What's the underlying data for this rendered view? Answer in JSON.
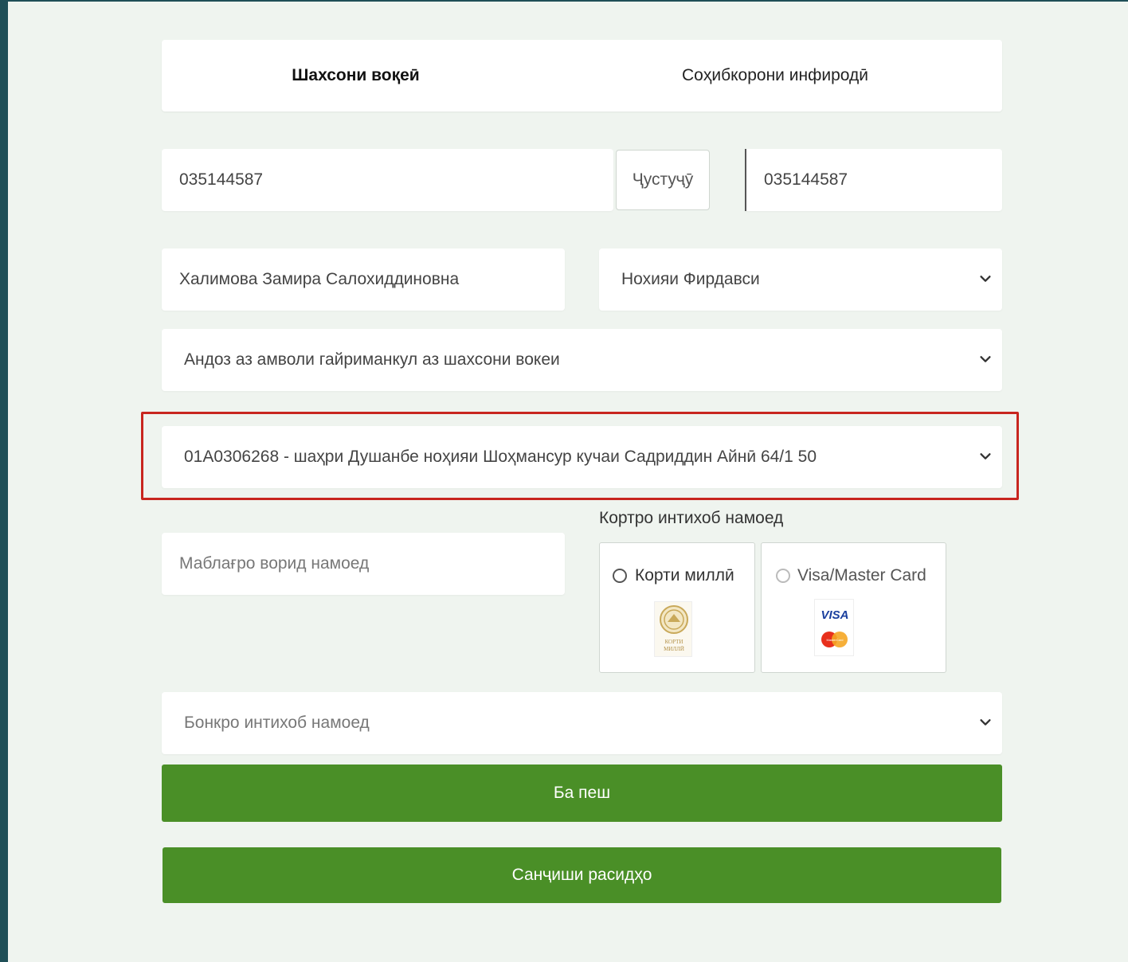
{
  "tabs": {
    "tab1": "Шахсони воқеӣ",
    "tab2": "Соҳибкорони инфиродӣ"
  },
  "tin_input": {
    "value": "035144587"
  },
  "search_button": {
    "label": "Ҷустуҷӯ"
  },
  "tin_result": {
    "value": "035144587"
  },
  "full_name": {
    "value": "Халимова Замира Салохиддиновна"
  },
  "district_select": {
    "value": "Нохияи Фирдавси"
  },
  "tax_type_select": {
    "value": "Андоз аз амволи гайриманкул аз шахсони вокеи"
  },
  "property_select": {
    "value": "01А0306268 - шаҳри Душанбе ноҳияи Шоҳмансур кучаи Садриддин Айнӣ 64/1 50"
  },
  "amount_input": {
    "placeholder": "Маблағро ворид намоед"
  },
  "card_section": {
    "label": "Кортро интихоб намоед",
    "option1": "Корти миллӣ",
    "option2": "Visa/Master Card",
    "milli_logo_text": "КОРТИ МИЛЛӢ",
    "visa_text": "VISA",
    "mastercard_text": "MasterCard"
  },
  "bank_select": {
    "placeholder": "Бонкро интихоб намоед"
  },
  "buttons": {
    "next": "Ба пеш",
    "check": "Санҷиши расидҳо"
  },
  "colors": {
    "primary_green": "#4a8f27",
    "highlight_red": "#c8261f",
    "background": "#eff4ef"
  },
  "icons": {
    "chevron": "chevron-down-icon",
    "radio": "radio-icon"
  }
}
